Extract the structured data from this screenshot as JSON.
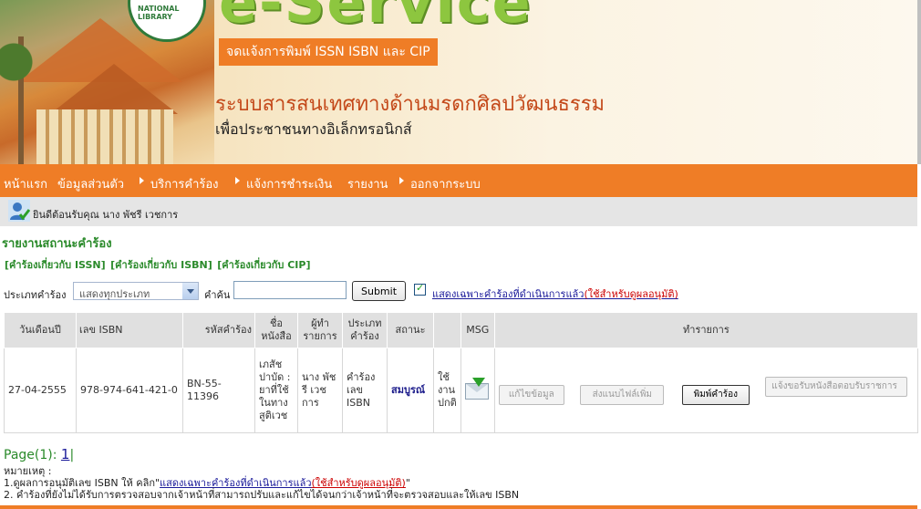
{
  "banner": {
    "logo_text": "e-Service",
    "seal_text": "NATIONAL LIBRARY",
    "tagline": "จดแจ้งการพิมพ์ ISSN ISBN และ CIP",
    "title": "ระบบสารสนเทศทางด้านมรดกศิลปวัฒนธรรม",
    "subtitle": "เพื่อประชาชนทางอิเล็กทรอนิกส์"
  },
  "nav": {
    "items": [
      "หน้าแรก",
      "ข้อมูลส่วนตัว",
      "บริการคำร้อง",
      "แจ้งการชำระเงิน",
      "รายงาน",
      "ออกจากระบบ"
    ]
  },
  "welcome": {
    "text": "ยินดีต้อนรับคุณ นาง พัชรี เวชการ"
  },
  "report": {
    "title": "รายงานสถานะคำร้อง",
    "links": [
      "[คำร้องเกี่ยวกับ ISSN]",
      "[คำร้องเกี่ยวกับ ISBN]",
      "[คำร้องเกี่ยวกับ CIP]"
    ]
  },
  "filter": {
    "type_label": "ประเภทคำร้อง",
    "type_value": "แสดงทุกประเภท",
    "search_label": "คำค้น",
    "search_value": "",
    "submit_label": "Submit",
    "checkbox_label": "แสดงเฉพาะคำร้องที่ดำเนินการแล้ว",
    "checkbox_note": "(ใช้สำหรับดูผลอนุมัติ)"
  },
  "table": {
    "headers": [
      "วันเดือนปี",
      "เลข ISBN",
      "รหัสคำร้อง",
      "ชื่อหนังสือ",
      "ผู้ทำรายการ",
      "ประเภทคำร้อง",
      "สถานะ",
      "",
      "MSG",
      "ทำรายการ"
    ],
    "row": {
      "date": "27-04-2555",
      "isbn": "978-974-641-421-0",
      "request_id": "BN-55-11396",
      "book_title": "เภสัชปาบัด : ยาที่ใช้ในทางสูติเวช",
      "requester": "นาง พัชรี เวชการ",
      "request_type": "คำร้องเลข ISBN",
      "status": "สมบูรณ์",
      "usage": "ใช้งานปกติ",
      "actions": [
        "แก้ไขข้อมูล",
        "ส่งแนบไฟล์เพิ่ม",
        "พิมพ์คำร้อง",
        "แจ้งขอรับหนังสือตอบรับราชการ"
      ]
    }
  },
  "pager": {
    "label": "Page(1):",
    "current": "1"
  },
  "notes": {
    "heading": "หมายเหตุ :",
    "line1_prefix": "1.ดูผลการอนุมัติเลข ISBN ให้ คลิก\"",
    "line1_link": "แสดงเฉพาะคำร้องที่ดำเนินการแล้ว",
    "line1_red": "(ใช้สำหรับดูผลอนุมัติ)",
    "line1_suffix": "\"",
    "line2": "2. คำร้องที่ยังไม่ได้รับการตรวจสอบจากเจ้าหน้าที่สามารถปรับและแก้ไขได้จนกว่าเจ้าหน้าที่จะตรวจสอบและให้เลข ISBN"
  },
  "colors": {
    "accent": "#ef7d26",
    "green": "#2a8a2a",
    "link": "#1a1a9a"
  }
}
